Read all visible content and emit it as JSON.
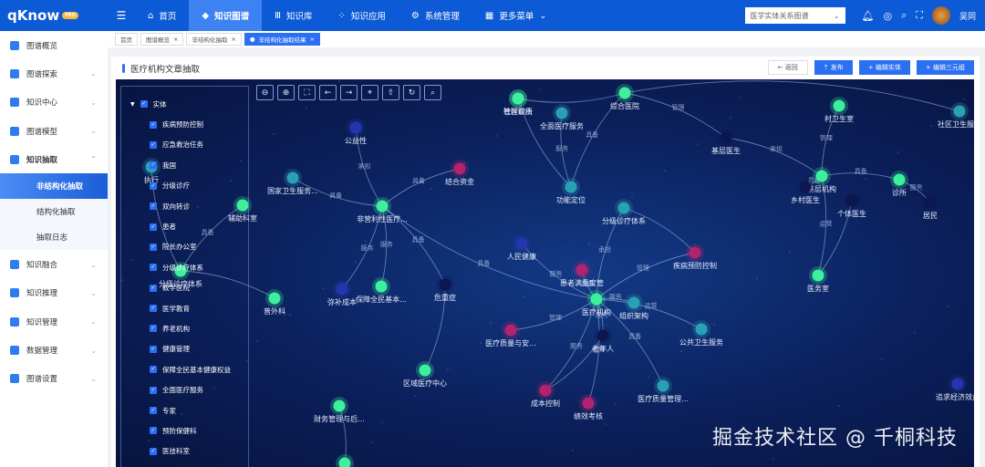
{
  "header": {
    "logo": "qKnow",
    "logo_badge": "PRO",
    "nav": [
      {
        "label": "首页",
        "icon": "home-icon"
      },
      {
        "label": "知识图谱",
        "icon": "graph-icon",
        "active": true
      },
      {
        "label": "知识库",
        "icon": "library-icon"
      },
      {
        "label": "知识应用",
        "icon": "app-icon"
      },
      {
        "label": "系统管理",
        "icon": "gear-icon"
      },
      {
        "label": "更多菜单",
        "icon": "grid-icon"
      }
    ],
    "graph_select": "医学实体关系图谱",
    "user": "吴同"
  },
  "sidebar": {
    "items": [
      {
        "label": "图谱概览"
      },
      {
        "label": "图谱探索"
      },
      {
        "label": "知识中心"
      },
      {
        "label": "图谱模型"
      },
      {
        "label": "知识抽取"
      },
      {
        "label": "知识融合"
      },
      {
        "label": "知识推理"
      },
      {
        "label": "知识管理"
      },
      {
        "label": "数据管理"
      },
      {
        "label": "图谱设置"
      }
    ],
    "sub": [
      "非结构化抽取",
      "结构化抽取",
      "抽取日志"
    ]
  },
  "tabs": [
    "首页",
    "图谱概览",
    "非结构化抽取",
    "非结构化抽取结果"
  ],
  "panel": {
    "title": "医疗机构文章抽取",
    "back": "← 返回",
    "publish": "⇡ 发布",
    "edit_entity": "+ 编辑实体",
    "edit_triple": "+ 编辑三元组"
  },
  "legend": {
    "root": "实体",
    "items": [
      "疾病预防控制",
      "应急救治任务",
      "我国",
      "分级诊疗",
      "双向转诊",
      "患者",
      "院长办公室",
      "分级诊疗体系",
      "教学医院",
      "医学教育",
      "养老机构",
      "健康管理",
      "保障全民基本健康权益",
      "全面医疗服务",
      "专家",
      "预防保健科",
      "医技科室"
    ]
  },
  "graph": {
    "nodes": [
      "管理职责",
      "社区诊所",
      "综合医院",
      "全面医疗服务",
      "公益性",
      "村卫生室",
      "社区卫生服务",
      "基层医生",
      "基层机构",
      "乡村医生",
      "诊所",
      "个体医生",
      "居民",
      "结合资金",
      "国家卫生服务...",
      "非营利性医疗...",
      "功能定位",
      "分级诊疗体系",
      "辅助科室",
      "执行",
      "人民健康",
      "疾病预防控制",
      "患者满意度管",
      "分级诊疗体系",
      "普外科",
      "弥补成本",
      "保障全民基本...",
      "危重症",
      "医疗机构",
      "组织架构",
      "医疗质量与安...",
      "老年人",
      "公共卫生服务",
      "医务室",
      "区域医疗中心",
      "成本控制",
      "绩效考核",
      "医疗质量管理...",
      "财务管理与后...",
      "追求经济效益",
      ""
    ],
    "edge_labels": [
      "具备",
      "承担",
      "管理",
      "具备",
      "服务",
      "管理",
      "服务",
      "运营",
      "服务",
      "运营",
      "具备",
      "服务",
      "承担",
      "具备",
      "具备",
      "服务",
      "服务",
      "具备",
      "具备",
      "服务",
      "管理",
      "承担",
      "管理",
      "具备",
      "服务",
      "具备",
      "运营",
      "具备"
    ]
  },
  "watermark": "掘金技术社区 @ 千桐科技",
  "colors": {
    "primary": "#0d5ad6",
    "accent": "#2b6ff2"
  }
}
